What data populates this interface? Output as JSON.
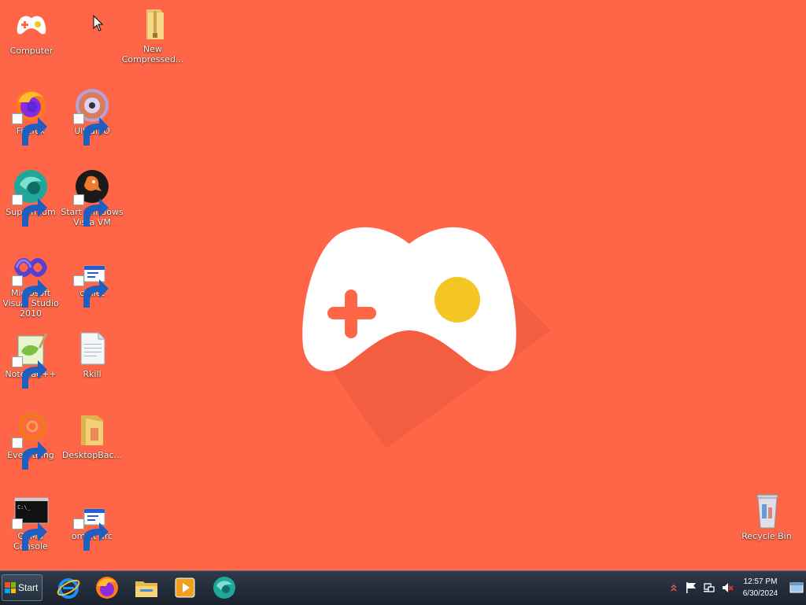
{
  "desktop": {
    "icons": [
      {
        "label": "Computer",
        "icon": "controller-icon"
      },
      {
        "label": "New Compressed...",
        "icon": "zip-folder-icon"
      },
      {
        "label": "Firefox",
        "icon": "firefox-icon"
      },
      {
        "label": "UltraISO",
        "icon": "disc-icon"
      },
      {
        "label": "Supermium",
        "icon": "supermium-icon"
      },
      {
        "label": "Start Windows Vista VM",
        "icon": "qemu-icon"
      },
      {
        "label": "Microsoft Visual Studio 2010",
        "icon": "visual-studio-icon"
      },
      {
        "label": "omlet",
        "icon": "app-window-icon"
      },
      {
        "label": "Notepad++",
        "icon": "notepad-plus-plus-icon"
      },
      {
        "label": "Rkill",
        "icon": "text-file-icon"
      },
      {
        "label": "Everything",
        "icon": "everything-icon"
      },
      {
        "label": "DesktopBac...",
        "icon": "folder-icon"
      },
      {
        "label": "QEMU Console",
        "icon": "console-icon"
      },
      {
        "label": "omlet arc",
        "icon": "app-window-icon"
      },
      {
        "label": "Recycle Bin",
        "icon": "recycle-bin-icon"
      }
    ]
  },
  "taskbar": {
    "start_label": "Start",
    "pinned": [
      "internet-explorer-icon",
      "firefox-icon",
      "file-explorer-icon",
      "media-player-icon",
      "supermium-icon"
    ],
    "tray": {
      "icons": [
        "show-hidden-icons-icon",
        "action-center-flag-icon",
        "network-icon",
        "volume-muted-icon"
      ],
      "time": "12:57 PM",
      "date": "6/30/2024"
    }
  },
  "colors": {
    "wallpaper": "#ff6647",
    "logo_body": "#ffffff",
    "logo_dpad": "#ff6647",
    "logo_button": "#f3c623",
    "taskbar": "#1f2833"
  }
}
